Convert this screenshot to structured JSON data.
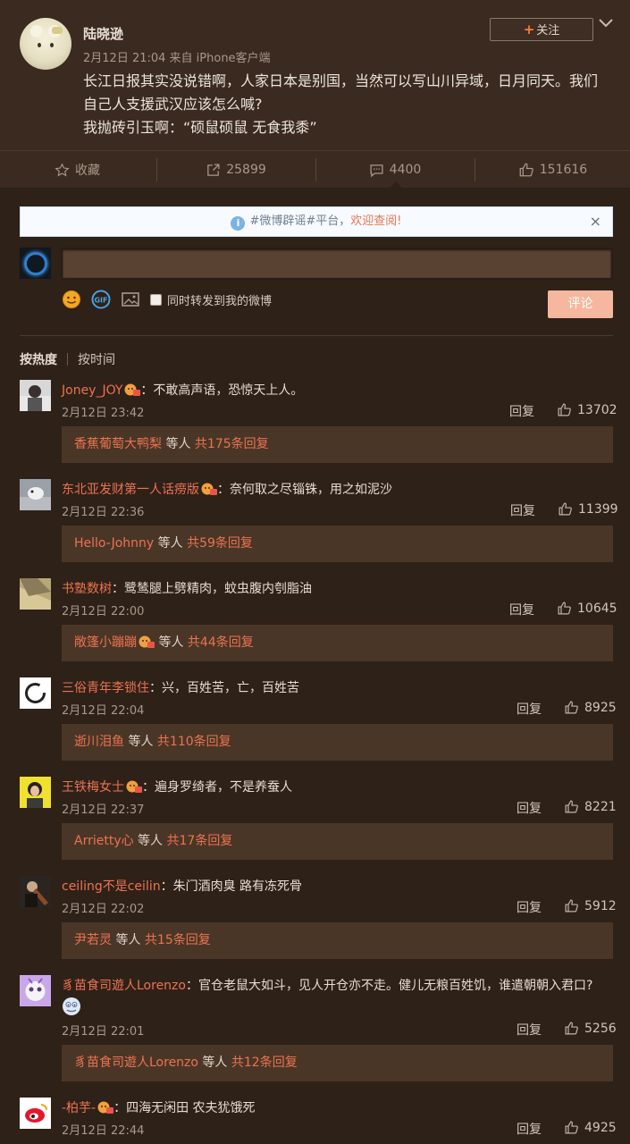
{
  "post": {
    "author": "陆晓逊",
    "meta": "2月12日 21:04 来自 iPhone客户端",
    "follow_label": "关注",
    "lines": [
      "长江日报其实没说错啊，人家日本是别国，当然可以写山川异域，日月同天。我们自己人支援武汉应该怎么喊?",
      "我抛砖引玉啊：“硕鼠硕鼠 无食我黍”"
    ]
  },
  "actions": {
    "favorite": "收藏",
    "repost": "25899",
    "comment": "4400",
    "like": "151616"
  },
  "notice": {
    "prefix": "#微博辟谣#平台，",
    "highlight": "欢迎查阅!",
    "close": "×"
  },
  "composer": {
    "repost_label": "同时转发到我的微博",
    "submit_label": "评论"
  },
  "sort": {
    "hot": "按热度",
    "time": "按时间"
  },
  "comments": [
    {
      "name": "Joney_JOY",
      "badge": true,
      "text": "：不敢高声语，恐惊天上人。",
      "date": "2月12日 23:42",
      "reply": "回复",
      "likes": "13702",
      "sub_user": "香蕉葡萄大鸭梨",
      "sub_mid": " 等人 ",
      "sub_count": "共175条回复"
    },
    {
      "name": "东北亚发财第一人话痨版",
      "badge": true,
      "text": "：奈何取之尽锱铢，用之如泥沙",
      "date": "2月12日 22:36",
      "reply": "回复",
      "likes": "11399",
      "sub_user": "Hello-Johnny",
      "sub_mid": " 等人 ",
      "sub_count": "共59条回复"
    },
    {
      "name": "书塾数树",
      "badge": false,
      "text": "：鹭鸶腿上劈精肉，蚊虫腹内刳脂油",
      "date": "2月12日 22:00",
      "reply": "回复",
      "likes": "10645",
      "sub_user": "敞篷小蹦蹦",
      "sub_mid": " 等人 ",
      "sub_count": "共44条回复",
      "sub_badge": true
    },
    {
      "name": "三俗青年李锁住",
      "badge": false,
      "text": "：兴，百姓苦，亡，百姓苦",
      "date": "2月12日 22:04",
      "reply": "回复",
      "likes": "8925",
      "sub_user": "逝川泪鱼",
      "sub_mid": " 等人 ",
      "sub_count": "共110条回复"
    },
    {
      "name": "王铁梅女士",
      "badge": true,
      "text": "：遍身罗绮者，不是养蚕人",
      "date": "2月12日 22:37",
      "reply": "回复",
      "likes": "8221",
      "sub_user": "Arrietty心",
      "sub_mid": " 等人 ",
      "sub_count": "共17条回复"
    },
    {
      "name": "ceiling不是ceilin",
      "badge": false,
      "text": "：朱门酒肉臭 路有冻死骨",
      "date": "2月12日 22:02",
      "reply": "回复",
      "likes": "5912",
      "sub_user": "尹若灵",
      "sub_mid": " 等人 ",
      "sub_count": "共15条回复"
    },
    {
      "name": "豸苗食司遊人Lorenzo",
      "badge": false,
      "text": "：官仓老鼠大如斗，见人开仓亦不走。健儿无粮百姓饥，谁遣朝朝入君口?",
      "date": "2月12日 22:01",
      "reply": "回复",
      "likes": "5256",
      "sub_user": "豸苗食司遊人Lorenzo",
      "sub_mid": " 等人 ",
      "sub_count": "共12条回复",
      "emoji": true
    },
    {
      "name": "-柏芋-",
      "badge": true,
      "text": "：四海无闲田 农夫犹饿死",
      "date": "2月12日 22:44",
      "reply": "回复",
      "likes": "4925"
    }
  ]
}
